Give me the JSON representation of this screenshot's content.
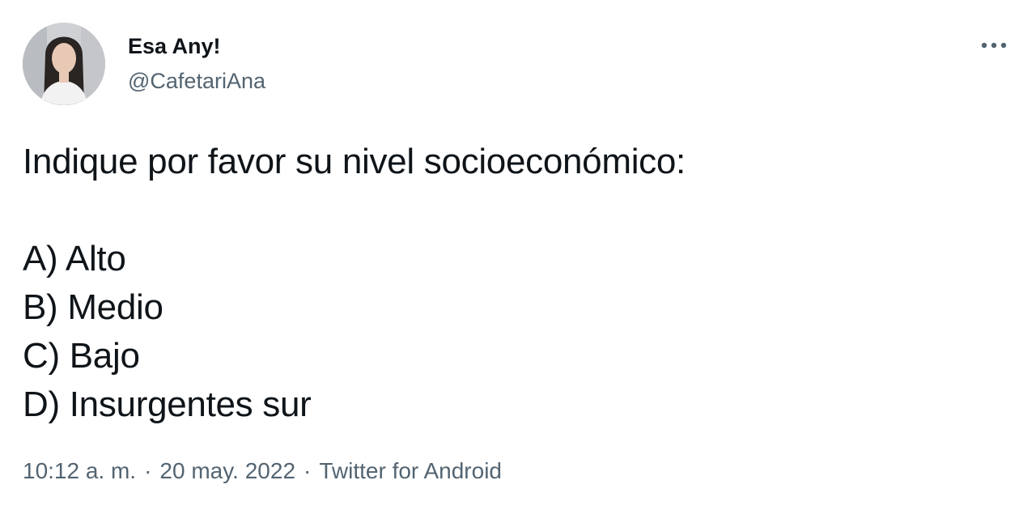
{
  "author": {
    "display_name": "Esa Any!",
    "handle": "@CafetariAna"
  },
  "tweet": {
    "title_line": "Indique por favor su nivel socioeconómico:",
    "options": [
      "A) Alto",
      "B) Medio",
      "C) Bajo",
      "D) Insurgentes sur"
    ]
  },
  "meta": {
    "time": "10:12 a. m.",
    "separator": "·",
    "date": "20 may. 2022",
    "source": "Twitter for Android"
  },
  "colors": {
    "text": "#0f1419",
    "secondary": "#536471",
    "background": "#ffffff"
  },
  "icons": {
    "more": "more-horizontal-icon",
    "avatar": "profile-photo"
  }
}
